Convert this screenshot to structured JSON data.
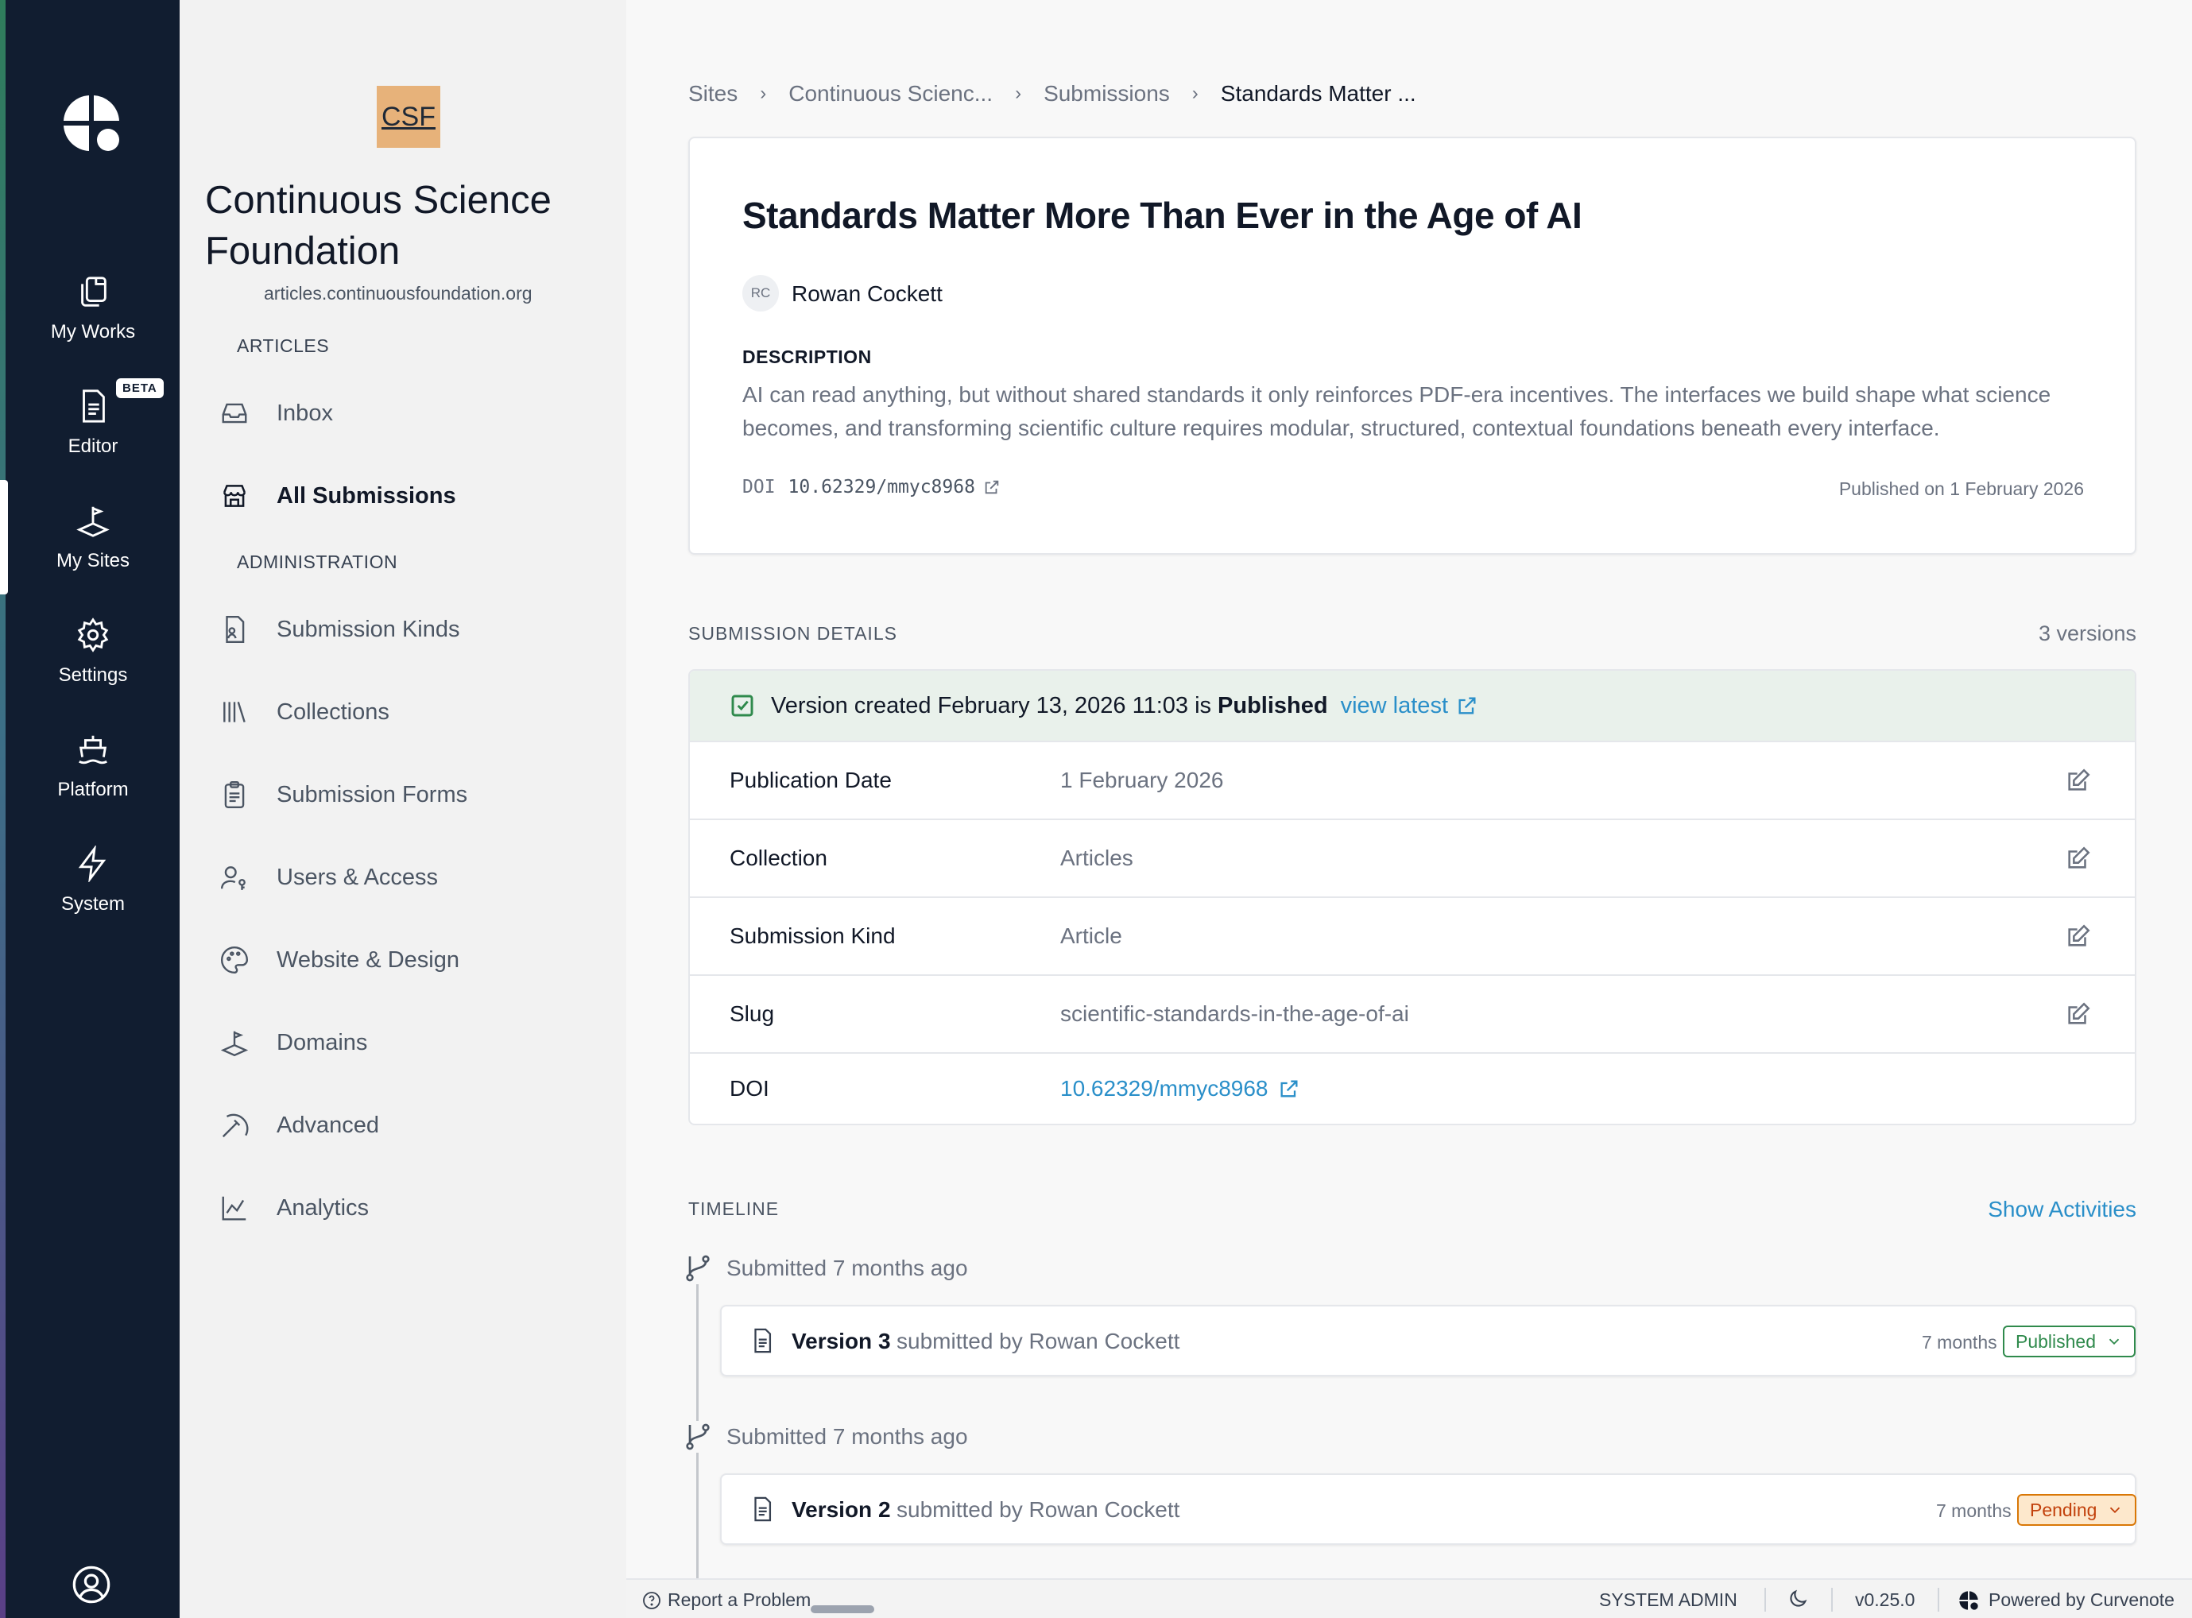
{
  "rail": {
    "items": [
      {
        "label": "My Works",
        "icon": "copy-documents-icon"
      },
      {
        "label": "Editor",
        "icon": "document-icon",
        "badge": "BETA"
      },
      {
        "label": "My Sites",
        "icon": "sites-icon"
      },
      {
        "label": "Settings",
        "icon": "gear-icon"
      },
      {
        "label": "Platform",
        "icon": "ship-icon"
      },
      {
        "label": "System",
        "icon": "lightning-icon"
      }
    ],
    "active": "My Sites",
    "user_icon": "user-circle-icon"
  },
  "site": {
    "logo_text": "CSF",
    "name": "Continuous Science Foundation",
    "domain": "articles.continuousfoundation.org"
  },
  "sidebar": {
    "articles_heading": "ARTICLES",
    "article_items": [
      {
        "label": "Inbox",
        "icon": "inbox-icon"
      },
      {
        "label": "All Submissions",
        "icon": "storefront-icon",
        "active": true
      }
    ],
    "admin_heading": "ADMINISTRATION",
    "admin_items": [
      {
        "label": "Submission Kinds",
        "icon": "file-person-icon"
      },
      {
        "label": "Collections",
        "icon": "library-icon"
      },
      {
        "label": "Submission Forms",
        "icon": "clipboard-icon"
      },
      {
        "label": "Users & Access",
        "icon": "user-key-icon"
      },
      {
        "label": "Website & Design",
        "icon": "palette-icon"
      },
      {
        "label": "Domains",
        "icon": "domains-icon"
      },
      {
        "label": "Advanced",
        "icon": "pickaxe-icon"
      },
      {
        "label": "Analytics",
        "icon": "line-chart-icon"
      }
    ]
  },
  "breadcrumb": [
    "Sites",
    "Continuous Scienc...",
    "Submissions",
    "Standards Matter ..."
  ],
  "article": {
    "title": "Standards Matter More Than Ever in the Age of AI",
    "author_initials": "RC",
    "author": "Rowan Cockett",
    "description_label": "DESCRIPTION",
    "description": "AI can read anything, but without shared standards it only reinforces PDF-era incentives. The interfaces we build shape what science becomes, and transforming scientific culture requires modular, structured, contextual foundations beneath every interface.",
    "doi_label": "DOI",
    "doi": "10.62329/mmyc8968",
    "published_on": "Published on 1 February 2026"
  },
  "details": {
    "heading": "SUBMISSION DETAILS",
    "versions_count": "3 versions",
    "status_prefix": "Version created February 13, 2026 11:03 is",
    "status_value": "Published",
    "view_latest": "view latest",
    "rows": [
      {
        "key": "Publication Date",
        "value": "1 February 2026"
      },
      {
        "key": "Collection",
        "value": "Articles"
      },
      {
        "key": "Submission Kind",
        "value": "Article"
      },
      {
        "key": "Slug",
        "value": "scientific-standards-in-the-age-of-ai"
      },
      {
        "key": "DOI",
        "value": "10.62329/mmyc8968"
      }
    ]
  },
  "timeline": {
    "heading": "TIMELINE",
    "show_activities": "Show Activities",
    "events": [
      {
        "event": "Submitted 7 months ago",
        "version": "Version 3",
        "by": "submitted by Rowan Cockett",
        "ago": "7 months ago",
        "status": "Published"
      },
      {
        "event": "Submitted 7 months ago",
        "version": "Version 2",
        "by": "submitted by Rowan Cockett",
        "ago": "7 months ago",
        "status": "Pending"
      }
    ]
  },
  "footer": {
    "report": "Report a Problem",
    "role": "SYSTEM ADMIN",
    "version": "v0.25.0",
    "powered": "Powered by Curvenote"
  },
  "colors": {
    "rail_bg": "#111d30",
    "link": "#2a8fc9",
    "published_green": "#2f8a4c",
    "pending_orange": "#d97706",
    "status_row_bg": "#e9f1eb"
  }
}
